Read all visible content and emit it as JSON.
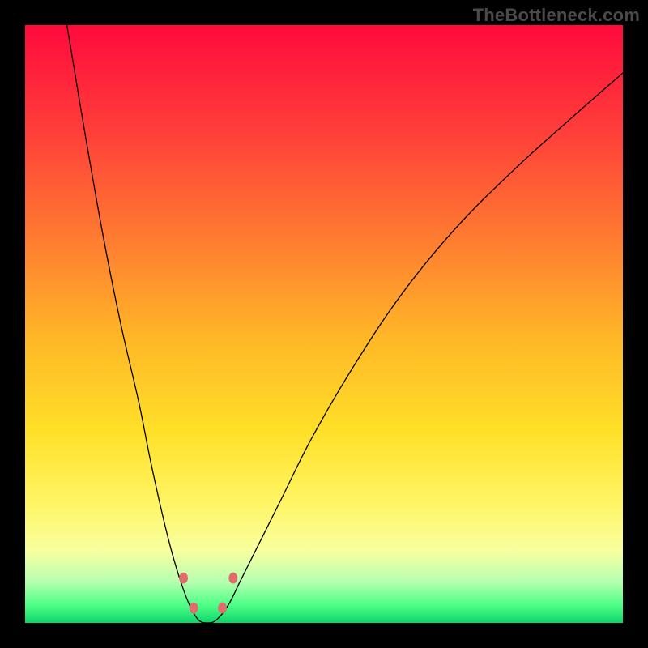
{
  "watermark": "TheBottleneck.com",
  "chart_data": {
    "type": "line",
    "title": "",
    "xlabel": "",
    "ylabel": "",
    "xlim": [
      0,
      100
    ],
    "ylim": [
      0,
      100
    ],
    "grid": false,
    "legend": false,
    "background_gradient": {
      "direction": "vertical",
      "stops": [
        {
          "pos": 0.0,
          "color": "#ff0a3c"
        },
        {
          "pos": 0.18,
          "color": "#ff3f3a"
        },
        {
          "pos": 0.4,
          "color": "#ff8a2f"
        },
        {
          "pos": 0.52,
          "color": "#ffb627"
        },
        {
          "pos": 0.68,
          "color": "#ffe028"
        },
        {
          "pos": 0.8,
          "color": "#fff565"
        },
        {
          "pos": 0.88,
          "color": "#f8ffa0"
        },
        {
          "pos": 0.93,
          "color": "#b8ffb0"
        },
        {
          "pos": 0.97,
          "color": "#4fff86"
        },
        {
          "pos": 1.0,
          "color": "#0cd66b"
        }
      ]
    },
    "series": [
      {
        "name": "curve",
        "color": "#000000",
        "width": 1.3,
        "x": [
          7,
          10,
          13,
          16,
          19,
          21,
          23,
          24.5,
          26,
          27.5,
          29,
          30.5,
          32,
          34,
          36,
          39,
          43,
          48,
          55,
          63,
          72,
          82,
          92,
          100
        ],
        "y": [
          100,
          82,
          65,
          50,
          37,
          27,
          18,
          12,
          7,
          3,
          0.5,
          0,
          0.5,
          3,
          7,
          13,
          21,
          31,
          43,
          55,
          66,
          76,
          85,
          92
        ]
      }
    ],
    "markers": [
      {
        "name": "marker-left-upper",
        "x": 26.5,
        "y": 7.5,
        "r": 6,
        "color": "#e26b6b"
      },
      {
        "name": "marker-left-lower",
        "x": 28.2,
        "y": 2.5,
        "r": 6,
        "color": "#e26b6b"
      },
      {
        "name": "marker-right-lower",
        "x": 33.0,
        "y": 2.5,
        "r": 6,
        "color": "#e26b6b"
      },
      {
        "name": "marker-right-upper",
        "x": 34.8,
        "y": 7.5,
        "r": 6,
        "color": "#e26b6b"
      }
    ]
  }
}
